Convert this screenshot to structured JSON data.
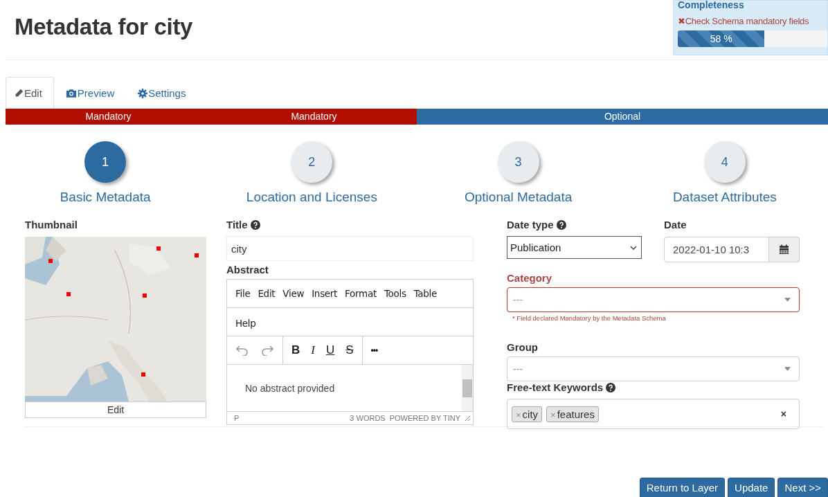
{
  "title": "Metadata for city",
  "completeness": {
    "heading": "Completeness",
    "warning_symbol": "✖",
    "warning": "Check Schema mandatory fields",
    "level": 0.58,
    "reading": "58 %"
  },
  "tabs": [
    {
      "label": "Edit",
      "selected": true
    },
    {
      "label": "Preview",
      "selected": false
    },
    {
      "label": "Settings",
      "selected": false
    }
  ],
  "sections": [
    {
      "label": "Mandatory",
      "kind": "mandatory"
    },
    {
      "label": "Mandatory",
      "kind": "mandatory"
    },
    {
      "label": "Optional",
      "kind": "optional"
    }
  ],
  "steps": [
    {
      "number": "1",
      "label": "Basic Metadata",
      "selected": true
    },
    {
      "number": "2",
      "label": "Location and Licenses",
      "selected": false
    },
    {
      "number": "3",
      "label": "Optional Metadata",
      "selected": false
    },
    {
      "number": "4",
      "label": "Dataset Attributes",
      "selected": false
    }
  ],
  "thumbnail": {
    "label": "Thumbnail",
    "kind": "picture",
    "button": "Edit"
  },
  "title_field": {
    "label": "Title",
    "help": true,
    "value": "city"
  },
  "abstract": {
    "label": "Abstract",
    "menu": [
      "File",
      "Edit",
      "View",
      "Insert",
      "Format",
      "Tools",
      "Table",
      "Help"
    ],
    "toolbar": [
      [
        {
          "kind": "undo",
          "disabled": true
        },
        {
          "kind": "redo",
          "disabled": true
        }
      ],
      [
        {
          "kind": "bold",
          "label": "B"
        },
        {
          "kind": "italic",
          "label": "I"
        },
        {
          "kind": "underline",
          "label": "U"
        },
        {
          "kind": "strike",
          "label": "S"
        }
      ],
      [
        {
          "kind": "more",
          "label": "•••"
        }
      ]
    ],
    "text": "No abstract provided",
    "path": "P",
    "word_count": "3 WORDS",
    "branding": "POWERED BY TINY"
  },
  "date_type": {
    "label": "Date type",
    "help": true,
    "value": "Publication"
  },
  "date": {
    "label": "Date",
    "value": "2022-01-10 10:3"
  },
  "category": {
    "label": "Category",
    "placeholder": "---",
    "required": true,
    "error": "* Field declared Mandatory by the Metadata Schema"
  },
  "group": {
    "label": "Group",
    "placeholder": "---"
  },
  "keywords": {
    "label": "Free-text Keywords",
    "help": true,
    "remove_symbol": "×",
    "tags": [
      "city",
      "features"
    ],
    "clear_symbol": "×"
  },
  "buttons": [
    "Return to Layer",
    "Update",
    "Next >>"
  ]
}
